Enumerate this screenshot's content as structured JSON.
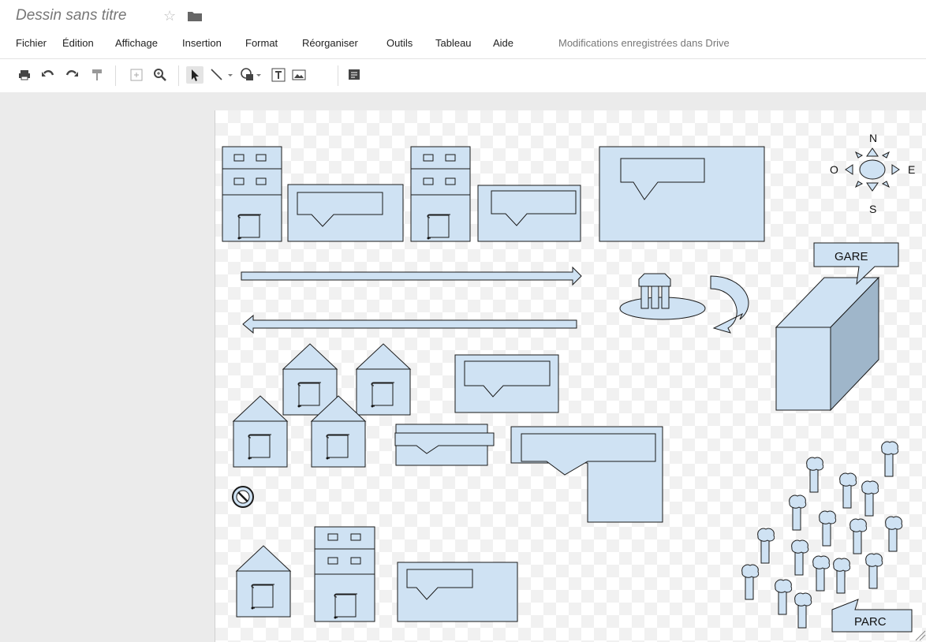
{
  "app": {
    "title": "Dessin sans titre",
    "save_status": "Modifications enregistrées dans Drive"
  },
  "menu": {
    "items": [
      "Fichier",
      "Édition",
      "Affichage",
      "Insertion",
      "Format",
      "Réorganiser",
      "Outils",
      "Tableau",
      "Aide"
    ]
  },
  "toolbar": {
    "icons": [
      "print-icon",
      "undo-icon",
      "redo-icon",
      "paint-format-icon",
      "zoom-fit-icon",
      "zoom-icon",
      "select-arrow-icon",
      "line-icon",
      "shape-icon",
      "text-box-icon",
      "image-icon",
      "comment-icon"
    ],
    "active_tool": "select-arrow-icon"
  },
  "drawing": {
    "compass": {
      "north": "N",
      "south": "S",
      "east": "E",
      "west": "O"
    },
    "labels": {
      "station": "GARE",
      "park": "PARC"
    }
  },
  "colors": {
    "shape_fill": "#cfe2f3",
    "shape_stroke": "#1a1a1a",
    "workspace_bg": "#ebebeb"
  }
}
